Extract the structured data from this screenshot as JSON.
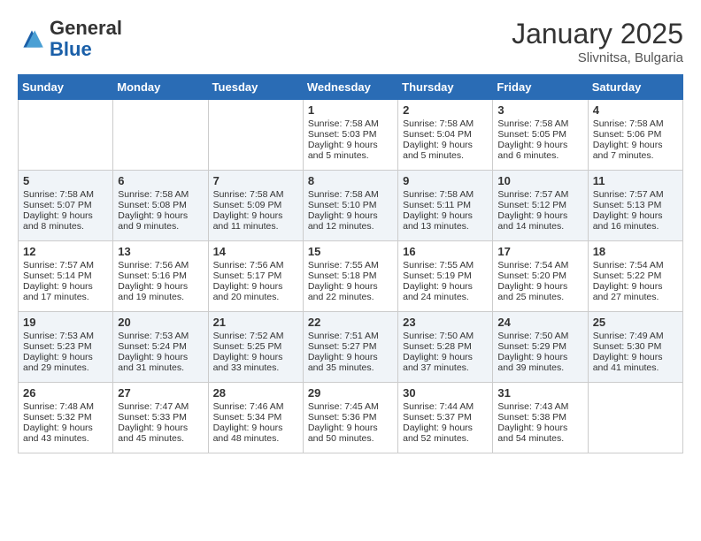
{
  "header": {
    "logo_general": "General",
    "logo_blue": "Blue",
    "title": "January 2025",
    "subtitle": "Slivnitsa, Bulgaria"
  },
  "calendar": {
    "days_of_week": [
      "Sunday",
      "Monday",
      "Tuesday",
      "Wednesday",
      "Thursday",
      "Friday",
      "Saturday"
    ],
    "weeks": [
      [
        {
          "day": "",
          "empty": true
        },
        {
          "day": "",
          "empty": true
        },
        {
          "day": "",
          "empty": true
        },
        {
          "day": "1",
          "sunrise": "7:58 AM",
          "sunset": "5:03 PM",
          "daylight": "9 hours and 5 minutes."
        },
        {
          "day": "2",
          "sunrise": "7:58 AM",
          "sunset": "5:04 PM",
          "daylight": "9 hours and 5 minutes."
        },
        {
          "day": "3",
          "sunrise": "7:58 AM",
          "sunset": "5:05 PM",
          "daylight": "9 hours and 6 minutes."
        },
        {
          "day": "4",
          "sunrise": "7:58 AM",
          "sunset": "5:06 PM",
          "daylight": "9 hours and 7 minutes."
        }
      ],
      [
        {
          "day": "5",
          "sunrise": "7:58 AM",
          "sunset": "5:07 PM",
          "daylight": "9 hours and 8 minutes."
        },
        {
          "day": "6",
          "sunrise": "7:58 AM",
          "sunset": "5:08 PM",
          "daylight": "9 hours and 9 minutes."
        },
        {
          "day": "7",
          "sunrise": "7:58 AM",
          "sunset": "5:09 PM",
          "daylight": "9 hours and 11 minutes."
        },
        {
          "day": "8",
          "sunrise": "7:58 AM",
          "sunset": "5:10 PM",
          "daylight": "9 hours and 12 minutes."
        },
        {
          "day": "9",
          "sunrise": "7:58 AM",
          "sunset": "5:11 PM",
          "daylight": "9 hours and 13 minutes."
        },
        {
          "day": "10",
          "sunrise": "7:57 AM",
          "sunset": "5:12 PM",
          "daylight": "9 hours and 14 minutes."
        },
        {
          "day": "11",
          "sunrise": "7:57 AM",
          "sunset": "5:13 PM",
          "daylight": "9 hours and 16 minutes."
        }
      ],
      [
        {
          "day": "12",
          "sunrise": "7:57 AM",
          "sunset": "5:14 PM",
          "daylight": "9 hours and 17 minutes."
        },
        {
          "day": "13",
          "sunrise": "7:56 AM",
          "sunset": "5:16 PM",
          "daylight": "9 hours and 19 minutes."
        },
        {
          "day": "14",
          "sunrise": "7:56 AM",
          "sunset": "5:17 PM",
          "daylight": "9 hours and 20 minutes."
        },
        {
          "day": "15",
          "sunrise": "7:55 AM",
          "sunset": "5:18 PM",
          "daylight": "9 hours and 22 minutes."
        },
        {
          "day": "16",
          "sunrise": "7:55 AM",
          "sunset": "5:19 PM",
          "daylight": "9 hours and 24 minutes."
        },
        {
          "day": "17",
          "sunrise": "7:54 AM",
          "sunset": "5:20 PM",
          "daylight": "9 hours and 25 minutes."
        },
        {
          "day": "18",
          "sunrise": "7:54 AM",
          "sunset": "5:22 PM",
          "daylight": "9 hours and 27 minutes."
        }
      ],
      [
        {
          "day": "19",
          "sunrise": "7:53 AM",
          "sunset": "5:23 PM",
          "daylight": "9 hours and 29 minutes."
        },
        {
          "day": "20",
          "sunrise": "7:53 AM",
          "sunset": "5:24 PM",
          "daylight": "9 hours and 31 minutes."
        },
        {
          "day": "21",
          "sunrise": "7:52 AM",
          "sunset": "5:25 PM",
          "daylight": "9 hours and 33 minutes."
        },
        {
          "day": "22",
          "sunrise": "7:51 AM",
          "sunset": "5:27 PM",
          "daylight": "9 hours and 35 minutes."
        },
        {
          "day": "23",
          "sunrise": "7:50 AM",
          "sunset": "5:28 PM",
          "daylight": "9 hours and 37 minutes."
        },
        {
          "day": "24",
          "sunrise": "7:50 AM",
          "sunset": "5:29 PM",
          "daylight": "9 hours and 39 minutes."
        },
        {
          "day": "25",
          "sunrise": "7:49 AM",
          "sunset": "5:30 PM",
          "daylight": "9 hours and 41 minutes."
        }
      ],
      [
        {
          "day": "26",
          "sunrise": "7:48 AM",
          "sunset": "5:32 PM",
          "daylight": "9 hours and 43 minutes."
        },
        {
          "day": "27",
          "sunrise": "7:47 AM",
          "sunset": "5:33 PM",
          "daylight": "9 hours and 45 minutes."
        },
        {
          "day": "28",
          "sunrise": "7:46 AM",
          "sunset": "5:34 PM",
          "daylight": "9 hours and 48 minutes."
        },
        {
          "day": "29",
          "sunrise": "7:45 AM",
          "sunset": "5:36 PM",
          "daylight": "9 hours and 50 minutes."
        },
        {
          "day": "30",
          "sunrise": "7:44 AM",
          "sunset": "5:37 PM",
          "daylight": "9 hours and 52 minutes."
        },
        {
          "day": "31",
          "sunrise": "7:43 AM",
          "sunset": "5:38 PM",
          "daylight": "9 hours and 54 minutes."
        },
        {
          "day": "",
          "empty": true
        }
      ]
    ]
  },
  "labels": {
    "sunrise_prefix": "Sunrise:",
    "sunset_prefix": "Sunset:",
    "daylight_prefix": "Daylight:"
  }
}
